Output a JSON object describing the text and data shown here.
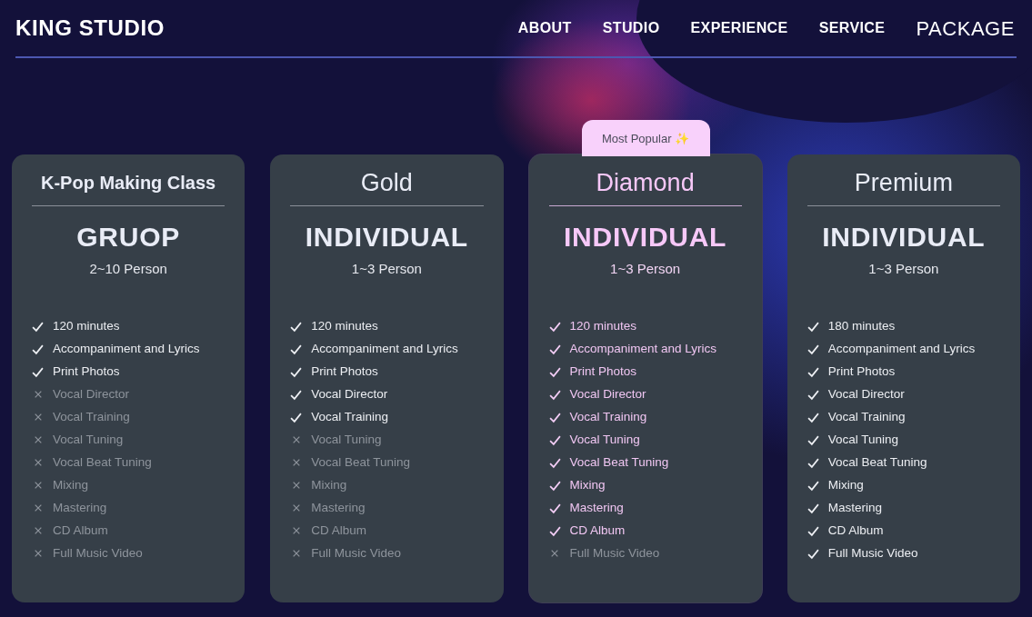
{
  "brand": "KING STUDIO",
  "nav": [
    {
      "label": "ABOUT",
      "selected": false
    },
    {
      "label": "STUDIO",
      "selected": false
    },
    {
      "label": "EXPERIENCE",
      "selected": false
    },
    {
      "label": "SERVICE",
      "selected": false
    },
    {
      "label": "PACKAGE",
      "selected": true
    }
  ],
  "plans": [
    {
      "title": "K-Pop Making Class",
      "type": "GRUOP",
      "people": "2~10 Person",
      "featured": false,
      "features": [
        {
          "label": "120 minutes",
          "included": true
        },
        {
          "label": "Accompaniment and Lyrics",
          "included": true
        },
        {
          "label": "Print Photos",
          "included": true
        },
        {
          "label": "Vocal Director",
          "included": false
        },
        {
          "label": "Vocal Training",
          "included": false
        },
        {
          "label": "Vocal Tuning",
          "included": false
        },
        {
          "label": "Vocal Beat Tuning",
          "included": false
        },
        {
          "label": "Mixing",
          "included": false
        },
        {
          "label": "Mastering",
          "included": false
        },
        {
          "label": "CD Album",
          "included": false
        },
        {
          "label": "Full Music Video",
          "included": false
        }
      ]
    },
    {
      "title": "Gold",
      "type": "INDIVIDUAL",
      "people": "1~3 Person",
      "featured": false,
      "features": [
        {
          "label": "120 minutes",
          "included": true
        },
        {
          "label": "Accompaniment and Lyrics",
          "included": true
        },
        {
          "label": "Print Photos",
          "included": true
        },
        {
          "label": "Vocal Director",
          "included": true
        },
        {
          "label": "Vocal Training",
          "included": true
        },
        {
          "label": "Vocal Tuning",
          "included": false
        },
        {
          "label": "Vocal Beat Tuning",
          "included": false
        },
        {
          "label": "Mixing",
          "included": false
        },
        {
          "label": "Mastering",
          "included": false
        },
        {
          "label": "CD Album",
          "included": false
        },
        {
          "label": "Full Music Video",
          "included": false
        }
      ]
    },
    {
      "title": "Diamond",
      "type": "INDIVIDUAL",
      "people": "1~3 Person",
      "featured": true,
      "badge": "Most Popular ✨",
      "features": [
        {
          "label": "120 minutes",
          "included": true
        },
        {
          "label": "Accompaniment and Lyrics",
          "included": true
        },
        {
          "label": "Print Photos",
          "included": true
        },
        {
          "label": "Vocal Director",
          "included": true
        },
        {
          "label": "Vocal Training",
          "included": true
        },
        {
          "label": "Vocal Tuning",
          "included": true
        },
        {
          "label": "Vocal Beat Tuning",
          "included": true
        },
        {
          "label": "Mixing",
          "included": true
        },
        {
          "label": "Mastering",
          "included": true
        },
        {
          "label": "CD Album",
          "included": true
        },
        {
          "label": "Full Music Video",
          "included": false
        }
      ]
    },
    {
      "title": "Premium",
      "type": "INDIVIDUAL",
      "people": "1~3 Person",
      "featured": false,
      "features": [
        {
          "label": "180 minutes",
          "included": true
        },
        {
          "label": "Accompaniment and Lyrics",
          "included": true
        },
        {
          "label": "Print Photos",
          "included": true
        },
        {
          "label": "Vocal Director",
          "included": true
        },
        {
          "label": "Vocal Training",
          "included": true
        },
        {
          "label": "Vocal Tuning",
          "included": true
        },
        {
          "label": "Vocal Beat Tuning",
          "included": true
        },
        {
          "label": "Mixing",
          "included": true
        },
        {
          "label": "Mastering",
          "included": true
        },
        {
          "label": "CD Album",
          "included": true
        },
        {
          "label": "Full Music Video",
          "included": true
        }
      ]
    }
  ]
}
